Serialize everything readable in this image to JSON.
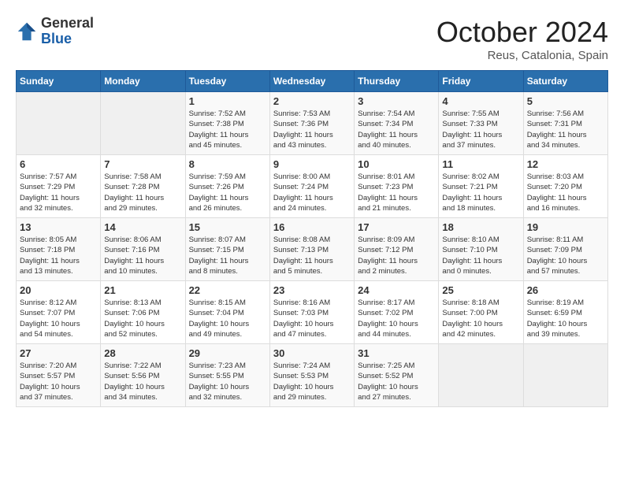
{
  "header": {
    "logo_general": "General",
    "logo_blue": "Blue",
    "month": "October 2024",
    "location": "Reus, Catalonia, Spain"
  },
  "columns": [
    "Sunday",
    "Monday",
    "Tuesday",
    "Wednesday",
    "Thursday",
    "Friday",
    "Saturday"
  ],
  "weeks": [
    [
      {
        "day": "",
        "info": ""
      },
      {
        "day": "",
        "info": ""
      },
      {
        "day": "1",
        "info": "Sunrise: 7:52 AM\nSunset: 7:38 PM\nDaylight: 11 hours\nand 45 minutes."
      },
      {
        "day": "2",
        "info": "Sunrise: 7:53 AM\nSunset: 7:36 PM\nDaylight: 11 hours\nand 43 minutes."
      },
      {
        "day": "3",
        "info": "Sunrise: 7:54 AM\nSunset: 7:34 PM\nDaylight: 11 hours\nand 40 minutes."
      },
      {
        "day": "4",
        "info": "Sunrise: 7:55 AM\nSunset: 7:33 PM\nDaylight: 11 hours\nand 37 minutes."
      },
      {
        "day": "5",
        "info": "Sunrise: 7:56 AM\nSunset: 7:31 PM\nDaylight: 11 hours\nand 34 minutes."
      }
    ],
    [
      {
        "day": "6",
        "info": "Sunrise: 7:57 AM\nSunset: 7:29 PM\nDaylight: 11 hours\nand 32 minutes."
      },
      {
        "day": "7",
        "info": "Sunrise: 7:58 AM\nSunset: 7:28 PM\nDaylight: 11 hours\nand 29 minutes."
      },
      {
        "day": "8",
        "info": "Sunrise: 7:59 AM\nSunset: 7:26 PM\nDaylight: 11 hours\nand 26 minutes."
      },
      {
        "day": "9",
        "info": "Sunrise: 8:00 AM\nSunset: 7:24 PM\nDaylight: 11 hours\nand 24 minutes."
      },
      {
        "day": "10",
        "info": "Sunrise: 8:01 AM\nSunset: 7:23 PM\nDaylight: 11 hours\nand 21 minutes."
      },
      {
        "day": "11",
        "info": "Sunrise: 8:02 AM\nSunset: 7:21 PM\nDaylight: 11 hours\nand 18 minutes."
      },
      {
        "day": "12",
        "info": "Sunrise: 8:03 AM\nSunset: 7:20 PM\nDaylight: 11 hours\nand 16 minutes."
      }
    ],
    [
      {
        "day": "13",
        "info": "Sunrise: 8:05 AM\nSunset: 7:18 PM\nDaylight: 11 hours\nand 13 minutes."
      },
      {
        "day": "14",
        "info": "Sunrise: 8:06 AM\nSunset: 7:16 PM\nDaylight: 11 hours\nand 10 minutes."
      },
      {
        "day": "15",
        "info": "Sunrise: 8:07 AM\nSunset: 7:15 PM\nDaylight: 11 hours\nand 8 minutes."
      },
      {
        "day": "16",
        "info": "Sunrise: 8:08 AM\nSunset: 7:13 PM\nDaylight: 11 hours\nand 5 minutes."
      },
      {
        "day": "17",
        "info": "Sunrise: 8:09 AM\nSunset: 7:12 PM\nDaylight: 11 hours\nand 2 minutes."
      },
      {
        "day": "18",
        "info": "Sunrise: 8:10 AM\nSunset: 7:10 PM\nDaylight: 11 hours\nand 0 minutes."
      },
      {
        "day": "19",
        "info": "Sunrise: 8:11 AM\nSunset: 7:09 PM\nDaylight: 10 hours\nand 57 minutes."
      }
    ],
    [
      {
        "day": "20",
        "info": "Sunrise: 8:12 AM\nSunset: 7:07 PM\nDaylight: 10 hours\nand 54 minutes."
      },
      {
        "day": "21",
        "info": "Sunrise: 8:13 AM\nSunset: 7:06 PM\nDaylight: 10 hours\nand 52 minutes."
      },
      {
        "day": "22",
        "info": "Sunrise: 8:15 AM\nSunset: 7:04 PM\nDaylight: 10 hours\nand 49 minutes."
      },
      {
        "day": "23",
        "info": "Sunrise: 8:16 AM\nSunset: 7:03 PM\nDaylight: 10 hours\nand 47 minutes."
      },
      {
        "day": "24",
        "info": "Sunrise: 8:17 AM\nSunset: 7:02 PM\nDaylight: 10 hours\nand 44 minutes."
      },
      {
        "day": "25",
        "info": "Sunrise: 8:18 AM\nSunset: 7:00 PM\nDaylight: 10 hours\nand 42 minutes."
      },
      {
        "day": "26",
        "info": "Sunrise: 8:19 AM\nSunset: 6:59 PM\nDaylight: 10 hours\nand 39 minutes."
      }
    ],
    [
      {
        "day": "27",
        "info": "Sunrise: 7:20 AM\nSunset: 5:57 PM\nDaylight: 10 hours\nand 37 minutes."
      },
      {
        "day": "28",
        "info": "Sunrise: 7:22 AM\nSunset: 5:56 PM\nDaylight: 10 hours\nand 34 minutes."
      },
      {
        "day": "29",
        "info": "Sunrise: 7:23 AM\nSunset: 5:55 PM\nDaylight: 10 hours\nand 32 minutes."
      },
      {
        "day": "30",
        "info": "Sunrise: 7:24 AM\nSunset: 5:53 PM\nDaylight: 10 hours\nand 29 minutes."
      },
      {
        "day": "31",
        "info": "Sunrise: 7:25 AM\nSunset: 5:52 PM\nDaylight: 10 hours\nand 27 minutes."
      },
      {
        "day": "",
        "info": ""
      },
      {
        "day": "",
        "info": ""
      }
    ]
  ]
}
